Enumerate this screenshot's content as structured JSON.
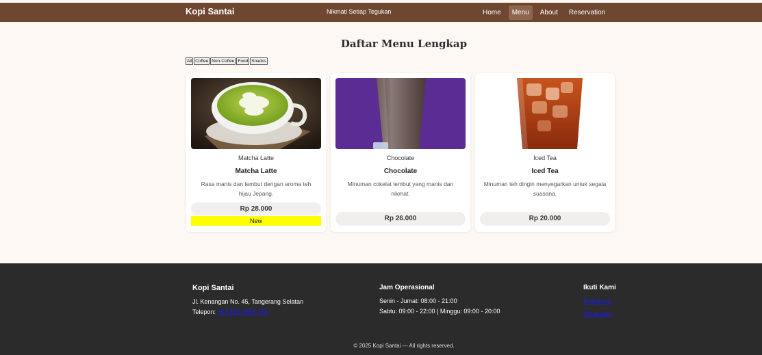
{
  "header": {
    "brand": "Kopi Santai",
    "tagline": "Nikmati Setiap Tegukan",
    "nav": [
      "Home",
      "Menu",
      "About",
      "Reservation"
    ],
    "active_nav": "Menu",
    "color": "#6f4630"
  },
  "main": {
    "title": "Daftar Menu Lengkap",
    "filters": [
      "All",
      "Coffee",
      "Non-Coffee",
      "Food",
      "Snacks"
    ],
    "cards": [
      {
        "image_alt": "Matcha Latte",
        "name": "Matcha Latte",
        "desc": "Rasa manis dan lembut dengan aroma teh hijau Jepang.",
        "price": "Rp 28.000",
        "badge": "New",
        "image_icon": "matcha-latte-photo"
      },
      {
        "image_alt": "Chocolate",
        "name": "Chocolate",
        "desc": "Minuman cokelat lembut yang manis dan nikmat.",
        "price": "Rp 26.000",
        "image_icon": "chocolate-drink-photo"
      },
      {
        "image_alt": "Iced Tea",
        "name": "Iced Tea",
        "desc": "Minuman teh dingin menyegarkan untuk segala suasana.",
        "price": "Rp 20.000",
        "image_icon": "iced-tea-photo"
      }
    ]
  },
  "footer": {
    "brand": "Kopi Santai",
    "address": "Jl. Kenangan No. 45, Tangerang Selatan",
    "phone_label": "Telepon:",
    "phone": "+62 812-3456-789",
    "hours_title": "Jam Operasional",
    "hours_1": "Senin - Jumat: 08:00 - 21:00",
    "hours_2": "Sabtu: 09:00 - 22:00 | Minggu: 09:00 - 20:00",
    "social_title": "Ikuti Kami",
    "social_links": [
      "Instagram",
      "WhatsApp"
    ],
    "copyright": "© 2025 Kopi Santai — All rights reserved."
  }
}
